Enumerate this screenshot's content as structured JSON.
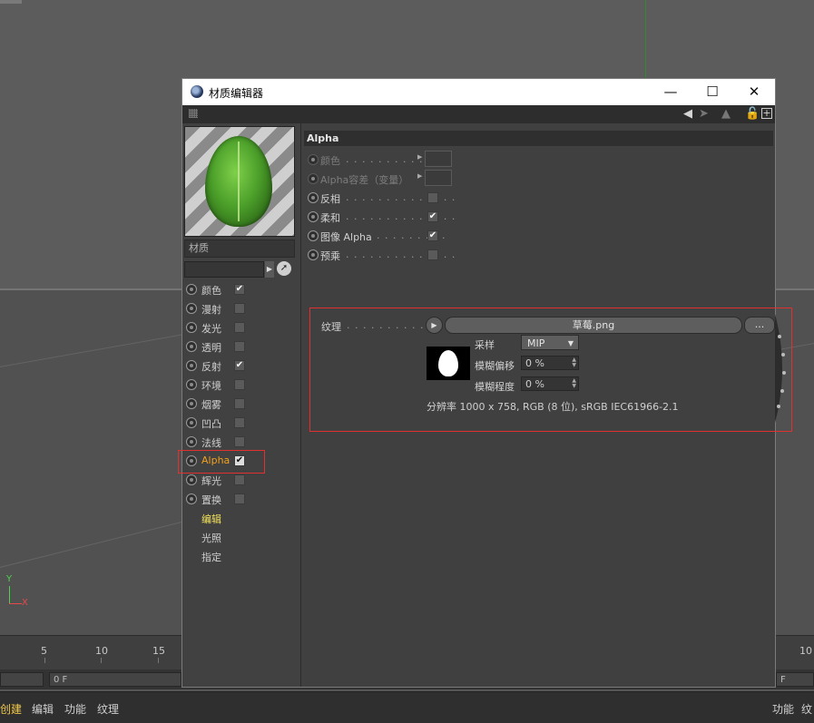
{
  "window": {
    "title": "材质编辑器",
    "controls": {
      "minimize": "—",
      "maximize": "☐",
      "close": "✕"
    }
  },
  "toolbar": {
    "icons": [
      "back-arrow-icon",
      "forward-arrow-icon",
      "up-arrow-icon",
      "lock-icon",
      "new-window-icon"
    ]
  },
  "left_panel": {
    "material_name": "材质",
    "channels": [
      {
        "label": "颜色",
        "checked": true
      },
      {
        "label": "漫射",
        "checked": false
      },
      {
        "label": "发光",
        "checked": false
      },
      {
        "label": "透明",
        "checked": false
      },
      {
        "label": "反射",
        "checked": true
      },
      {
        "label": "环境",
        "checked": false
      },
      {
        "label": "烟雾",
        "checked": false
      },
      {
        "label": "凹凸",
        "checked": false
      },
      {
        "label": "法线",
        "checked": false
      },
      {
        "label": "Alpha",
        "checked": true,
        "active": true
      },
      {
        "label": "辉光",
        "checked": false
      },
      {
        "label": "置换",
        "checked": false
      }
    ],
    "sections": [
      {
        "label": "编辑",
        "selected": true
      },
      {
        "label": "光照",
        "selected": false
      },
      {
        "label": "指定",
        "selected": false
      }
    ]
  },
  "right_panel": {
    "group_title": "Alpha",
    "params": [
      {
        "label": "颜色",
        "dots": ". . . . . . . . . . . .",
        "kind": "color",
        "disabled": true
      },
      {
        "label": "Alpha容差（变量）",
        "dots": "",
        "kind": "color",
        "disabled": true
      },
      {
        "label": "反相",
        "dots": ". . . . . . . . . . . . . .",
        "kind": "checkbox",
        "checked": false
      },
      {
        "label": "柔和",
        "dots": ". . . . . . . . . . . . . .",
        "kind": "checkbox",
        "checked": true
      },
      {
        "label": "图像 Alpha",
        "dots": ". . . . . . . . .",
        "kind": "checkbox",
        "checked": true
      },
      {
        "label": "预乘",
        "dots": ". . . . . . . . . . . . . .",
        "kind": "checkbox",
        "checked": false
      }
    ],
    "texture": {
      "label": "纹理",
      "dots": ". . . . . . . . . . . . .",
      "filename": "草莓.png",
      "more_button": "...",
      "sampling_label": "采样",
      "sampling_value": "MIP",
      "blur_offset_label": "模糊偏移",
      "blur_offset_value": "0 %",
      "blur_scale_label": "模糊程度",
      "blur_scale_value": "0 %",
      "resolution": "分辨率 1000 x 758, RGB (8 位), sRGB IEC61966-2.1"
    }
  },
  "viewport": {
    "axis_y": "Y",
    "axis_x": "X"
  },
  "timeline": {
    "ticks": [
      "5",
      "10",
      "15",
      "10"
    ],
    "frame_left": "0 F",
    "frame_right": "F"
  },
  "bottom_menu": {
    "items": [
      "创建",
      "编辑",
      "功能",
      "纹理"
    ],
    "right_items": [
      "功能",
      "纹"
    ]
  },
  "colors": {
    "accent": "#f0a020",
    "section_selected": "#f2e25a",
    "highlight_box": "#e03030"
  }
}
